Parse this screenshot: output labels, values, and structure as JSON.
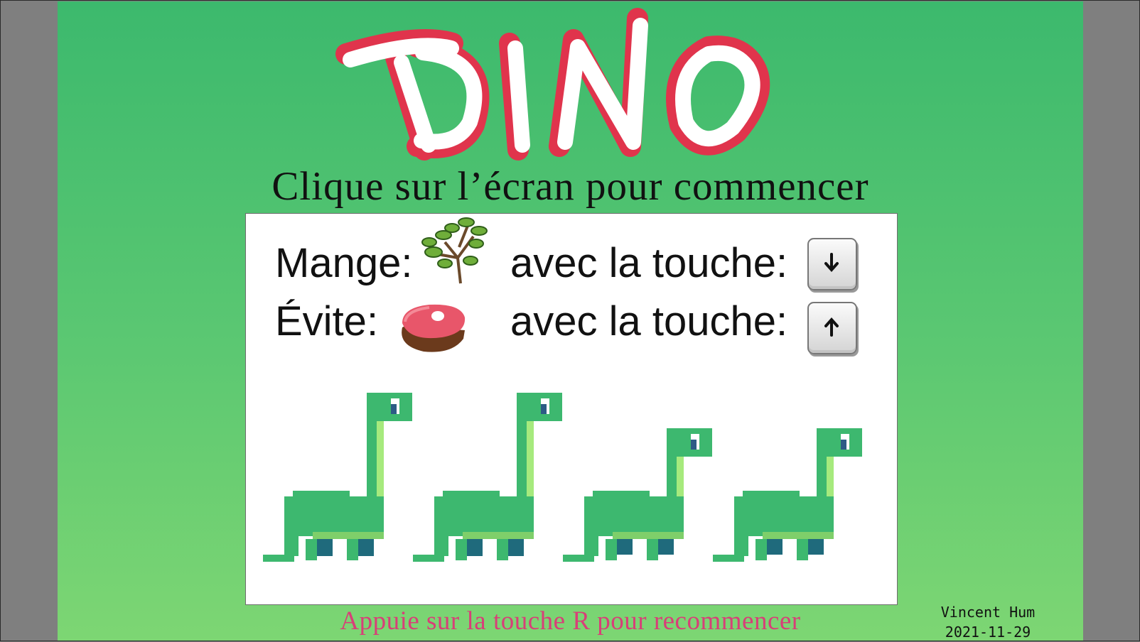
{
  "game": {
    "logo_text": "DINO",
    "start_instruction": "Clique sur l’écran pour commencer",
    "restart_instruction": "Appuie sur la touche R pour recommencer"
  },
  "instructions": [
    {
      "label": "Mange:",
      "item_icon": "plant-branch-icon",
      "key_text": "avec la touche:",
      "key_icon": "arrow-down-icon"
    },
    {
      "label": "Évite:",
      "item_icon": "meat-steak-icon",
      "key_text": "avec la touche:",
      "key_icon": "arrow-up-icon"
    }
  ],
  "dinos": [
    {
      "pose": "standing"
    },
    {
      "pose": "standing"
    },
    {
      "pose": "crouching"
    },
    {
      "pose": "crouching"
    }
  ],
  "credits": {
    "author": "Vincent Hum",
    "date": "2021-11-29"
  },
  "colors": {
    "background_top": "#3cb96d",
    "background_bottom": "#7dd673",
    "logo_red": "#e0344c",
    "restart_text": "#d83f78",
    "dino_green": "#3db86f",
    "dino_highlight": "#a6ea7d"
  }
}
